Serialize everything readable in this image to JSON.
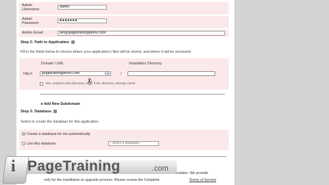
{
  "form": {
    "admin_username_label": "Admin\nUsername:",
    "admin_username_value": "admin",
    "admin_password_label": "Admin\nPassword:",
    "admin_password_value": "●●●●●●●",
    "admin_email_label": "Admin Email:",
    "admin_email_value": "ian@ipagetrainingdemo.com"
  },
  "step2": {
    "title": "Step 2: Path to Application",
    "description": "Fill in the fields below to choose where your application's files will be stored, and where it will be accessed.",
    "domain_header": "Domain / URL",
    "install_dir_header": "Installation Directory",
    "protocol": "http://",
    "domain_value": "ipagetrainingdemo.com",
    "slash": "/",
    "install_dir_value": "",
    "install_checkbox_label": "Yes, install to this directory, even if the directory already exists",
    "add_subdomain": "Add New Subdomain"
  },
  "step3": {
    "title": "Step 3: Database",
    "description": "Select or create the database for this application.",
    "option_create": "Create a database for me automatically.",
    "option_use": "Use this database:",
    "select_placeholder": "- Select a Database -"
  },
  "footer": {
    "partial_text_1": "installer. We provide",
    "partial_text_2": "only for the installation or upgrade process. Please review the Complete",
    "terms_link": "Terms of Service"
  },
  "watermark": {
    "brand_initial": "i",
    "brand_name": "PageTraining",
    "brand_tld": ".com"
  },
  "colors": {
    "row_background": "#fbe9ea",
    "gutter": "#d4d4d4"
  }
}
